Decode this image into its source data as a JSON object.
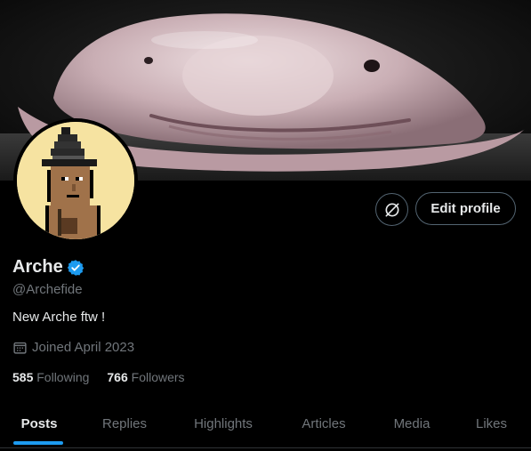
{
  "profile": {
    "display_name": "Arche",
    "handle": "@Archefide",
    "bio": "New Arche ftw !",
    "joined": "Joined April 2023",
    "verified": true
  },
  "actions": {
    "edit_label": "Edit profile",
    "icon_button": "unlink-icon"
  },
  "stats": {
    "following_count": "585",
    "following_label": "Following",
    "followers_count": "766",
    "followers_label": "Followers"
  },
  "tabs": [
    {
      "label": "Posts",
      "active": true
    },
    {
      "label": "Replies",
      "active": false
    },
    {
      "label": "Highlights",
      "active": false
    },
    {
      "label": "Articles",
      "active": false
    },
    {
      "label": "Media",
      "active": false
    },
    {
      "label": "Likes",
      "active": false
    }
  ],
  "colors": {
    "background": "#000000",
    "accent": "#1d9bf0",
    "text_primary": "#e7e9ea",
    "text_secondary": "#71767b",
    "border": "#536471"
  },
  "icons": {
    "verified": "verified-badge-icon",
    "calendar": "calendar-icon"
  }
}
